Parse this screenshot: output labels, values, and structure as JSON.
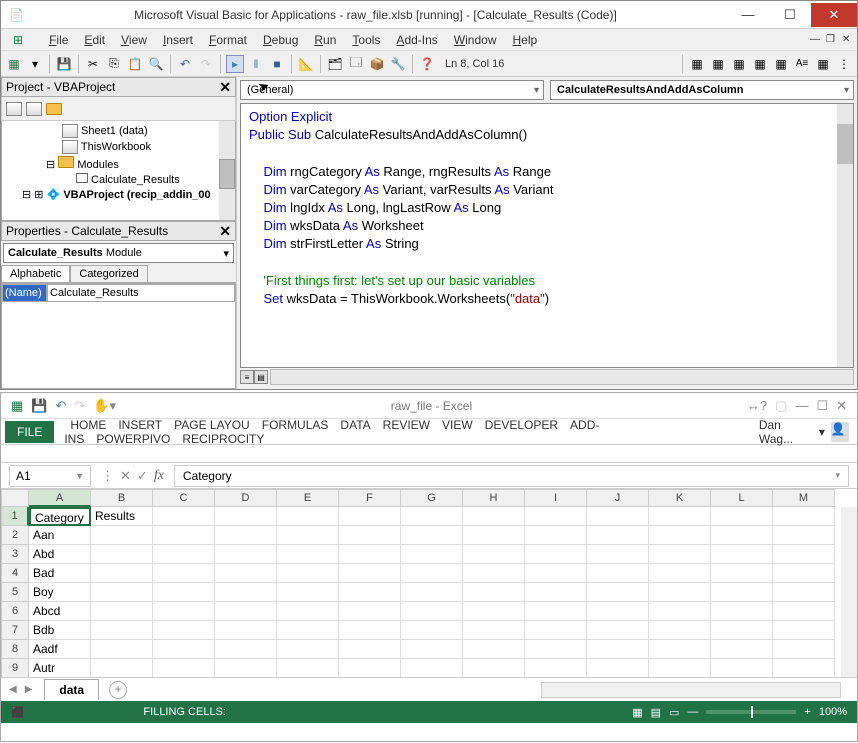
{
  "vba": {
    "title": "Microsoft Visual Basic for Applications - raw_file.xlsb [running] - [Calculate_Results (Code)]",
    "menu": [
      "File",
      "Edit",
      "View",
      "Insert",
      "Format",
      "Debug",
      "Run",
      "Tools",
      "Add-Ins",
      "Window",
      "Help"
    ],
    "cursor_pos": "Ln 8, Col 16",
    "project": {
      "header": "Project - VBAProject",
      "tree": [
        {
          "label": "Sheet1 (data)",
          "indent": 60,
          "icon": "sheet"
        },
        {
          "label": "ThisWorkbook",
          "indent": 60,
          "icon": "sheet"
        },
        {
          "label": "Modules",
          "indent": 44,
          "icon": "folder"
        },
        {
          "label": "Calculate_Results",
          "indent": 74,
          "icon": "module"
        },
        {
          "label": "VBAProject (recip_addin_00",
          "indent": 20,
          "icon": "project",
          "bold": true
        }
      ]
    },
    "props": {
      "header": "Properties - Calculate_Results",
      "object": "Calculate_Results",
      "object_type": "Module",
      "tabs": [
        "Alphabetic",
        "Categorized"
      ],
      "rows": [
        {
          "k": "(Name)",
          "v": "Calculate_Results"
        }
      ]
    },
    "combos": {
      "left": "(General)",
      "right": "CalculateResultsAndAddAsColumn"
    },
    "code_lines": [
      {
        "indent": 0,
        "tokens": [
          {
            "t": "Option Explicit",
            "c": "kw"
          }
        ]
      },
      {
        "indent": 0,
        "tokens": [
          {
            "t": "Public Sub",
            "c": "kw"
          },
          {
            "t": " CalculateResultsAndAddAsColumn()"
          }
        ]
      },
      {
        "indent": 0,
        "tokens": []
      },
      {
        "indent": 1,
        "tokens": [
          {
            "t": "Dim",
            "c": "kw"
          },
          {
            "t": " rngCategory "
          },
          {
            "t": "As",
            "c": "kw"
          },
          {
            "t": " Range, rngResults "
          },
          {
            "t": "As",
            "c": "kw"
          },
          {
            "t": " Range"
          }
        ]
      },
      {
        "indent": 1,
        "tokens": [
          {
            "t": "Dim",
            "c": "kw"
          },
          {
            "t": " varCategory "
          },
          {
            "t": "As",
            "c": "kw"
          },
          {
            "t": " Variant, varResults "
          },
          {
            "t": "As",
            "c": "kw"
          },
          {
            "t": " Variant"
          }
        ]
      },
      {
        "indent": 1,
        "tokens": [
          {
            "t": "Dim",
            "c": "kw"
          },
          {
            "t": " lngIdx "
          },
          {
            "t": "As",
            "c": "kw"
          },
          {
            "t": " Long, lngLastRow "
          },
          {
            "t": "As",
            "c": "kw"
          },
          {
            "t": " Long"
          }
        ]
      },
      {
        "indent": 1,
        "tokens": [
          {
            "t": "Dim",
            "c": "kw"
          },
          {
            "t": " wksData "
          },
          {
            "t": "As",
            "c": "kw"
          },
          {
            "t": " Worksheet"
          }
        ]
      },
      {
        "indent": 1,
        "tokens": [
          {
            "t": "Dim",
            "c": "kw"
          },
          {
            "t": " strFirstLetter "
          },
          {
            "t": "As",
            "c": "kw"
          },
          {
            "t": " String"
          }
        ]
      },
      {
        "indent": 0,
        "tokens": []
      },
      {
        "indent": 1,
        "tokens": [
          {
            "t": "'First things first: let's set up our basic variables",
            "c": "cm"
          }
        ]
      },
      {
        "indent": 1,
        "tokens": [
          {
            "t": "Set",
            "c": "kw"
          },
          {
            "t": " wksData = ThisWorkbook.Worksheets("
          },
          {
            "t": "\"data\"",
            "c": "st"
          },
          {
            "t": ")"
          }
        ]
      }
    ]
  },
  "excel": {
    "title": "raw_file - Excel",
    "ribbon": [
      "HOME",
      "INSERT",
      "PAGE LAYOU",
      "FORMULAS",
      "DATA",
      "REVIEW",
      "VIEW",
      "DEVELOPER",
      "ADD-INS",
      "POWERPIVO",
      "RECIPROCITY"
    ],
    "file_tab": "FILE",
    "user": "Dan Wag...",
    "name_box": "A1",
    "formula": "Category",
    "cols": [
      "A",
      "B",
      "C",
      "D",
      "E",
      "F",
      "G",
      "H",
      "I",
      "J",
      "K",
      "L",
      "M"
    ],
    "rows": [
      {
        "n": "1",
        "cells": [
          "Category",
          "Results"
        ]
      },
      {
        "n": "2",
        "cells": [
          "Aan"
        ]
      },
      {
        "n": "3",
        "cells": [
          "Abd"
        ]
      },
      {
        "n": "4",
        "cells": [
          "Bad"
        ]
      },
      {
        "n": "5",
        "cells": [
          "Boy"
        ]
      },
      {
        "n": "6",
        "cells": [
          "Abcd"
        ]
      },
      {
        "n": "7",
        "cells": [
          "Bdb"
        ]
      },
      {
        "n": "8",
        "cells": [
          "Aadf"
        ]
      },
      {
        "n": "9",
        "cells": [
          "Autr"
        ]
      }
    ],
    "sheet_tab": "data",
    "status_left": "⬛",
    "status_filling": "FILLING CELLS:",
    "zoom": "100%"
  }
}
